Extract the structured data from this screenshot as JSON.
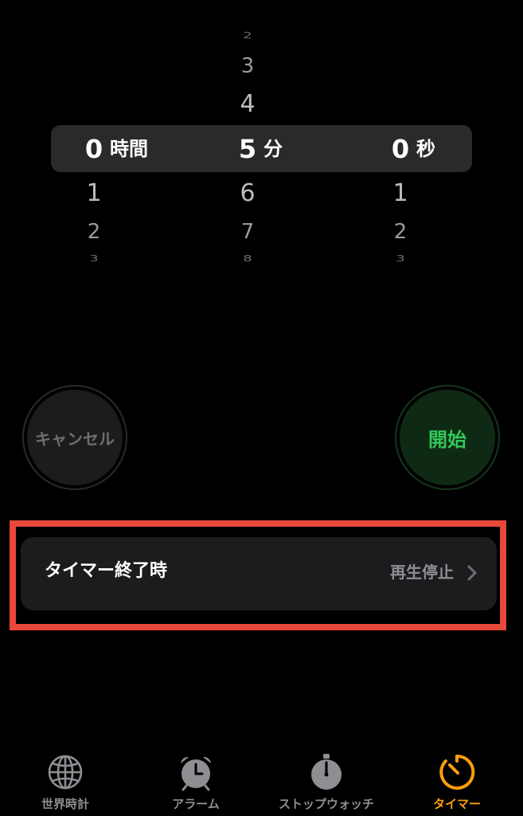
{
  "picker": {
    "hours": {
      "above": [
        "",
        "",
        ""
      ],
      "selected": "0",
      "unit": "時間",
      "below": [
        "1",
        "2",
        "3"
      ]
    },
    "minutes": {
      "above": [
        "2",
        "3",
        "4"
      ],
      "selected": "5",
      "unit": "分",
      "below": [
        "6",
        "7",
        "8"
      ]
    },
    "seconds": {
      "above": [
        "",
        "",
        ""
      ],
      "selected": "0",
      "unit": "秒",
      "below": [
        "1",
        "2",
        "3"
      ]
    }
  },
  "buttons": {
    "cancel_label": "キャンセル",
    "start_label": "開始"
  },
  "timer_end": {
    "label": "タイマー終了時",
    "value": "再生停止"
  },
  "tabbar": {
    "items": [
      {
        "label": "世界時計",
        "icon": "globe-icon"
      },
      {
        "label": "アラーム",
        "icon": "alarm-clock-icon"
      },
      {
        "label": "ストップウォッチ",
        "icon": "stopwatch-icon"
      },
      {
        "label": "タイマー",
        "icon": "timer-icon",
        "active": true
      }
    ]
  },
  "colors": {
    "accent": "#ff9f0a",
    "start_green": "#34c759",
    "highlight_red": "#e8483a"
  }
}
